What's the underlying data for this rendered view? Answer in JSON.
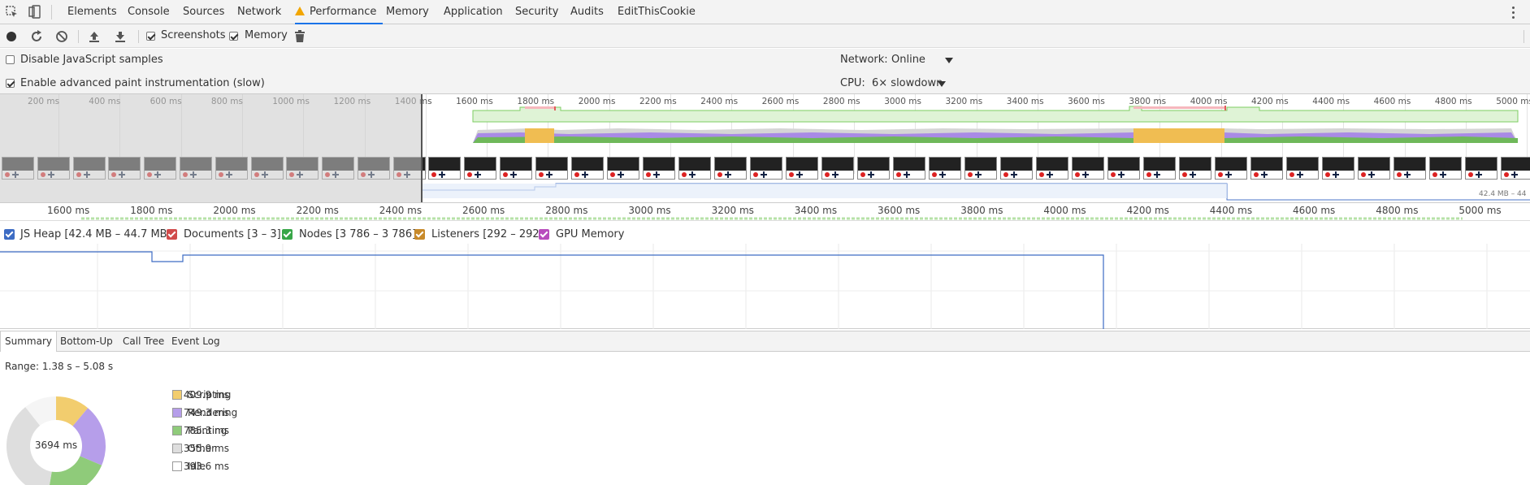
{
  "tabs": [
    {
      "label": "Elements"
    },
    {
      "label": "Console"
    },
    {
      "label": "Sources"
    },
    {
      "label": "Network"
    },
    {
      "label": "Performance"
    },
    {
      "label": "Memory"
    },
    {
      "label": "Application"
    },
    {
      "label": "Security"
    },
    {
      "label": "Audits"
    },
    {
      "label": "EditThisCookie"
    }
  ],
  "toolbar": {
    "screenshots_label": "Screenshots",
    "memory_label": "Memory"
  },
  "settings": {
    "disable_js_label": "Disable JavaScript samples",
    "advanced_paint_label": "Enable advanced paint instrumentation (slow)",
    "network_label": "Network:",
    "network_value": "Online",
    "cpu_label": "CPU:",
    "cpu_value": "6× slowdown"
  },
  "overview": {
    "ticks": [
      "200 ms",
      "400 ms",
      "600 ms",
      "800 ms",
      "1000 ms",
      "1200 ms",
      "1400 ms",
      "1600 ms",
      "1800 ms",
      "2000 ms",
      "2200 ms",
      "2400 ms",
      "2600 ms",
      "2800 ms",
      "3000 ms",
      "3200 ms",
      "3400 ms",
      "3600 ms",
      "3800 ms",
      "4000 ms",
      "4200 ms",
      "4400 ms",
      "4600 ms",
      "4800 ms",
      "5000 ms"
    ],
    "heap_label": "42.4 MB – 44"
  },
  "ruler": {
    "ticks": [
      "1600 ms",
      "1800 ms",
      "2000 ms",
      "2200 ms",
      "2400 ms",
      "2600 ms",
      "2800 ms",
      "3000 ms",
      "3200 ms",
      "3400 ms",
      "3600 ms",
      "3800 ms",
      "4000 ms",
      "4200 ms",
      "4400 ms",
      "4600 ms",
      "4800 ms",
      "5000 ms"
    ]
  },
  "counters": [
    {
      "label": "JS Heap [42.4 MB – 44.7 MB]",
      "color": "#3d6cc4"
    },
    {
      "label": "Documents [3 – 3]",
      "color": "#d14b4b"
    },
    {
      "label": "Nodes [3 786 – 3 786]",
      "color": "#38a648"
    },
    {
      "label": "Listeners [292 – 292]",
      "color": "#c88a2a"
    },
    {
      "label": "GPU Memory",
      "color": "#b84dbd"
    }
  ],
  "bottom_tabs": [
    {
      "label": "Summary"
    },
    {
      "label": "Bottom-Up"
    },
    {
      "label": "Call Tree"
    },
    {
      "label": "Event Log"
    }
  ],
  "summary": {
    "range": "Range: 1.38 s – 5.08 s",
    "total": "3694 ms",
    "items": [
      {
        "value": "409.9 ms",
        "name": "Scripting",
        "color": "#f2cd6e",
        "ms": 409.9
      },
      {
        "value": "749.3 ms",
        "name": "Rendering",
        "color": "#b69eea",
        "ms": 749.3
      },
      {
        "value": "785.3 ms",
        "name": "Painting",
        "color": "#8fcb7a",
        "ms": 785.3
      },
      {
        "value": "1355.9 ms",
        "name": "Other",
        "color": "#dedede",
        "ms": 1355.9
      },
      {
        "value": "393.6 ms",
        "name": "Idle",
        "color": "#ffffff",
        "ms": 393.6
      }
    ]
  }
}
